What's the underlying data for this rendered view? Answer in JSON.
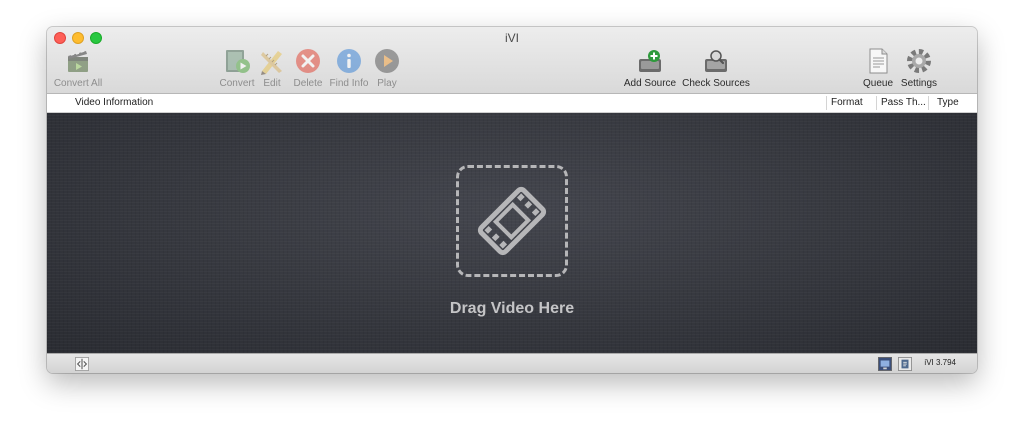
{
  "window": {
    "title": "iVI"
  },
  "toolbar": {
    "convert_all": {
      "label": "Convert All",
      "icon": "clapperboard-icon"
    },
    "convert": {
      "label": "Convert",
      "icon": "convert-icon"
    },
    "edit": {
      "label": "Edit",
      "icon": "pencil-ruler-icon"
    },
    "delete": {
      "label": "Delete",
      "icon": "x-circle-icon"
    },
    "find_info": {
      "label": "Find Info",
      "icon": "info-icon"
    },
    "play": {
      "label": "Play",
      "icon": "play-icon"
    },
    "add_source": {
      "label": "Add Source",
      "icon": "add-drive-icon"
    },
    "check_sources": {
      "label": "Check Sources",
      "icon": "search-drive-icon"
    },
    "queue": {
      "label": "Queue",
      "icon": "document-icon"
    },
    "settings": {
      "label": "Settings",
      "icon": "gear-icon"
    }
  },
  "table": {
    "columns": [
      "Video Information",
      "Format",
      "Pass Th...",
      "Type"
    ]
  },
  "dropzone": {
    "text": "Drag Video Here",
    "icon": "film-strip-icon"
  },
  "statusbar": {
    "version": "iVI 3.794"
  },
  "colors": {
    "close": "#fe5f57",
    "minimize": "#febc2e",
    "maximize": "#28c840",
    "dropzone_bg": "#34363c"
  }
}
